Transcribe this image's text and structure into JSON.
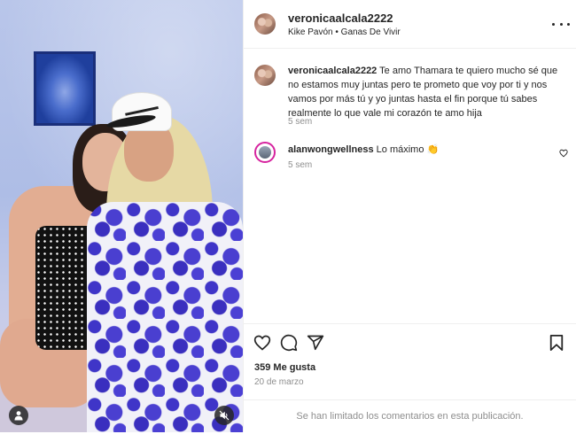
{
  "post": {
    "owner_username": "veronicaalcala2222",
    "audio_artist": "Kike Pavón",
    "audio_separator": "•",
    "audio_title": "Ganas De Vivir"
  },
  "comments": [
    {
      "username": "veronicaalcala2222",
      "text": "Te amo Thamara te quiero mucho sé que no estamos muy juntas pero te prometo que voy por ti y nos vamos por más tú y yo juntas hasta el fin porque tú sabes realmente lo que vale mi corazón te amo hija",
      "time": "5 sem"
    },
    {
      "username": "alanwongwellness",
      "text": "Lo máximo 👏",
      "time": "5 sem"
    }
  ],
  "engagement": {
    "likes": "359 Me gusta",
    "date": "20 de marzo"
  },
  "footer": {
    "comments_limited": "Se han limitado los comentarios en esta publicación."
  },
  "icons": {
    "like": "heart-icon",
    "comment": "comment-icon",
    "share": "share-icon",
    "save": "bookmark-icon",
    "more": "more-options-icon",
    "user_tag": "person-icon",
    "mute": "muted-speaker-icon"
  },
  "colors": {
    "text": "#262626",
    "secondary_text": "#8e8e8e",
    "border": "#efefef"
  }
}
